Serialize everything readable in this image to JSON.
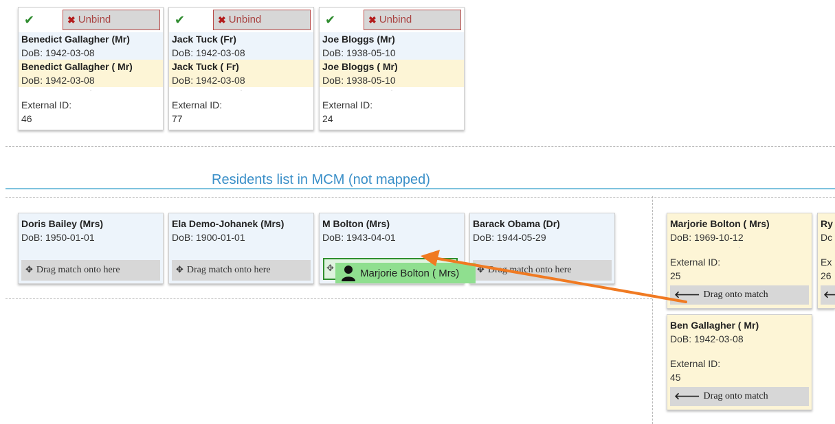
{
  "mapped": [
    {
      "unbind_label": "Unbind",
      "name1": "Benedict Gallagher (Mr)",
      "dob1": "DoB: 1942-03-08",
      "name2": "Benedict Gallagher ( Mr)",
      "dob2": "DoB: 1942-03-08",
      "ext_label": "External ID:",
      "ext_id": "46"
    },
    {
      "unbind_label": "Unbind",
      "name1": "Jack Tuck (Fr)",
      "dob1": "DoB: 1942-03-08",
      "name2": "Jack Tuck ( Fr)",
      "dob2": "DoB: 1942-03-08",
      "ext_label": "External ID:",
      "ext_id": "77"
    },
    {
      "unbind_label": "Unbind",
      "name1": "Joe Bloggs (Mr)",
      "dob1": "DoB: 1938-05-10",
      "name2": "Joe Bloggs ( Mr)",
      "dob2": "DoB: 1938-05-10",
      "ext_label": "External ID:",
      "ext_id": "24"
    }
  ],
  "section_title": "Residents list in MCM (not mapped)",
  "residents": [
    {
      "name": "Doris Bailey (Mrs)",
      "dob": "DoB: 1950-01-01",
      "drop_label": "Drag match onto here"
    },
    {
      "name": "Ela Demo-Johanek (Mrs)",
      "dob": "DoB: 1900-01-01",
      "drop_label": "Drag match onto here"
    },
    {
      "name": "M Bolton (Mrs)",
      "dob": "DoB: 1943-04-01",
      "drop_label": ""
    },
    {
      "name": "Barack Obama (Dr)",
      "dob": "DoB: 1944-05-29",
      "drop_label": "Drag match onto here"
    }
  ],
  "dragging_label": "Marjorie Bolton ( Mrs)",
  "matches": [
    {
      "name": "Marjorie Bolton ( Mrs)",
      "dob": "DoB: 1969-10-12",
      "ext_label": "External ID:",
      "ext_id": "25",
      "drag_label": "Drag onto match"
    },
    {
      "name": "Ben Gallagher ( Mr)",
      "dob": "DoB: 1942-03-08",
      "ext_label": "External ID:",
      "ext_id": "45",
      "drag_label": "Drag onto match"
    }
  ],
  "partial_match": {
    "name": "Ry",
    "dob": "Dc",
    "ext_label": "Ex",
    "ext_id": "26"
  },
  "colors": {
    "accent": "#3a8fc8",
    "arrow": "#f07a22",
    "drop_active": "#8fdf8f"
  }
}
